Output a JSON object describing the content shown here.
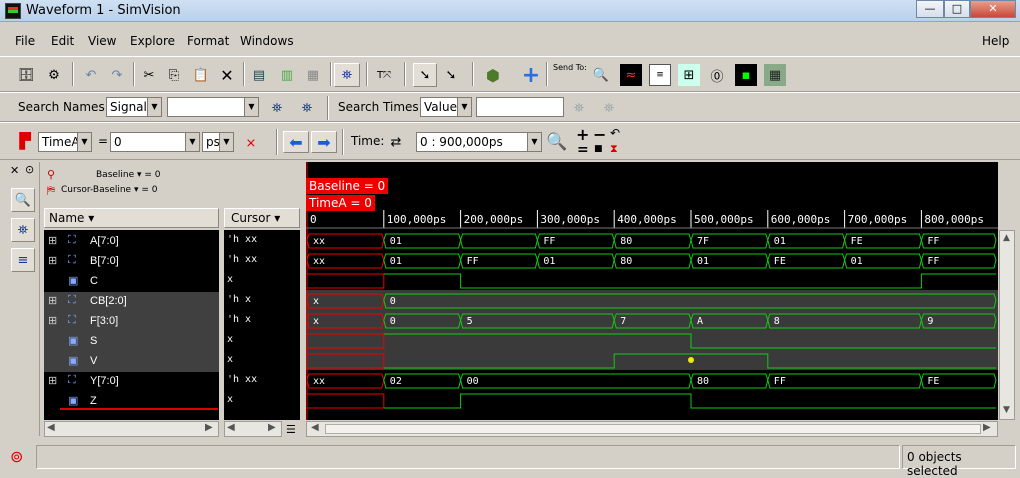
{
  "window": {
    "title": "Waveform 1 - SimVision",
    "min": "—",
    "max": "□",
    "close": "✕"
  },
  "menu": {
    "items": [
      "File",
      "Edit",
      "View",
      "Explore",
      "Format",
      "Windows"
    ],
    "help": "Help"
  },
  "toolbar": {
    "send_to": "Send To:"
  },
  "search": {
    "names_label": "Search Names:",
    "names_mode": "Signal",
    "names_value": "",
    "times_label": "Search Times:",
    "times_mode": "Value",
    "times_value": ""
  },
  "cursorbar": {
    "cursor": "TimeA",
    "eq": "=",
    "value": "0",
    "unit": "ps",
    "time_label": "Time:",
    "time_range": "0 : 900,000ps",
    "plus": "+",
    "minus": "−",
    "equal": "=",
    "square": "■"
  },
  "side": {
    "baseline": "Baseline ▾ = 0",
    "cursor_baseline": "Cursor-Baseline ▾ = 0"
  },
  "columns": {
    "name": "Name ▾",
    "cursor": "Cursor ▾"
  },
  "markers": {
    "baseline": "Baseline = 0",
    "timea": "TimeA = 0"
  },
  "ticks": [
    "0",
    "100,000ps",
    "200,000ps",
    "300,000ps",
    "400,000ps",
    "500,000ps",
    "600,000ps",
    "700,000ps",
    "800,000ps"
  ],
  "signals": [
    {
      "name": "A[7:0]",
      "bus": true,
      "cursor": "'h xx",
      "segments": [
        [
          0,
          1,
          "xx"
        ],
        [
          1,
          2,
          "01"
        ],
        [
          2,
          3,
          ""
        ],
        [
          3,
          4,
          "FF"
        ],
        [
          4,
          5,
          "80"
        ],
        [
          5,
          6,
          "7F"
        ],
        [
          6,
          7,
          "01"
        ],
        [
          7,
          8,
          "FE"
        ],
        [
          8,
          9,
          "FF"
        ]
      ]
    },
    {
      "name": "B[7:0]",
      "bus": true,
      "cursor": "'h xx",
      "segments": [
        [
          0,
          1,
          "xx"
        ],
        [
          1,
          2,
          "01"
        ],
        [
          2,
          3,
          "FF"
        ],
        [
          3,
          4,
          "01"
        ],
        [
          4,
          5,
          "80"
        ],
        [
          5,
          6,
          "01"
        ],
        [
          6,
          7,
          "FE"
        ],
        [
          7,
          8,
          "01"
        ],
        [
          8,
          9,
          "FF"
        ]
      ]
    },
    {
      "name": "C",
      "bus": false,
      "cursor": "x",
      "levels": [
        [
          0,
          1,
          "x"
        ],
        [
          1,
          2,
          1
        ],
        [
          2,
          8,
          0
        ],
        [
          8,
          9,
          1
        ]
      ]
    },
    {
      "name": "CB[2:0]",
      "bus": true,
      "cursor": "'h x",
      "segments": [
        [
          0,
          1,
          "x"
        ],
        [
          1,
          9,
          "0"
        ]
      ]
    },
    {
      "name": "F[3:0]",
      "bus": true,
      "cursor": "'h x",
      "segments": [
        [
          0,
          1,
          "x"
        ],
        [
          1,
          2,
          "0"
        ],
        [
          2,
          4,
          "5"
        ],
        [
          4,
          5,
          "7"
        ],
        [
          5,
          6,
          "A"
        ],
        [
          6,
          8,
          "8"
        ],
        [
          8,
          9,
          "9"
        ]
      ]
    },
    {
      "name": "S",
      "bus": false,
      "cursor": "x",
      "levels": [
        [
          0,
          1,
          "x"
        ],
        [
          1,
          5,
          1
        ],
        [
          5,
          9,
          0
        ]
      ]
    },
    {
      "name": "V",
      "bus": false,
      "cursor": "x",
      "levels": [
        [
          0,
          1,
          "x"
        ],
        [
          1,
          4,
          0
        ],
        [
          4,
          6,
          1
        ],
        [
          6,
          9,
          0
        ]
      ]
    },
    {
      "name": "Y[7:0]",
      "bus": true,
      "cursor": "'h xx",
      "segments": [
        [
          0,
          1,
          "xx"
        ],
        [
          1,
          2,
          "02"
        ],
        [
          2,
          5,
          "00"
        ],
        [
          5,
          6,
          "80"
        ],
        [
          6,
          8,
          "FF"
        ],
        [
          8,
          9,
          "FE"
        ]
      ]
    },
    {
      "name": "Z",
      "bus": false,
      "cursor": "x",
      "levels": [
        [
          0,
          1,
          "x"
        ],
        [
          1,
          2,
          0
        ],
        [
          2,
          5,
          1
        ],
        [
          5,
          9,
          0
        ]
      ]
    }
  ],
  "status": {
    "text": "0 objects selected"
  }
}
